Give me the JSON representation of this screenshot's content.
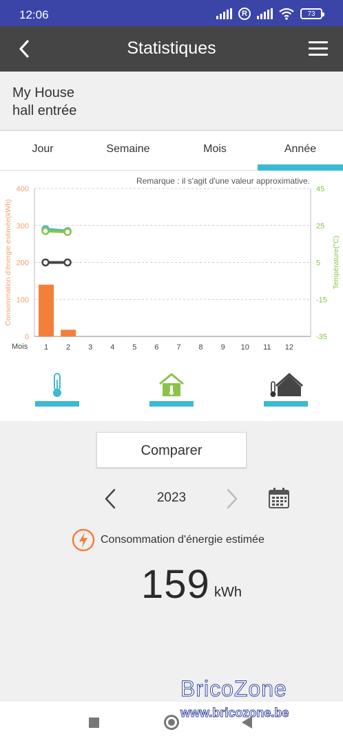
{
  "status_bar": {
    "time": "12:06",
    "battery": "73"
  },
  "app_bar": {
    "title": "Statistiques"
  },
  "device": {
    "home": "My House",
    "room": "hall entrée"
  },
  "tabs": [
    {
      "label": "Jour",
      "active": false
    },
    {
      "label": "Semaine",
      "active": false
    },
    {
      "label": "Mois",
      "active": false
    },
    {
      "label": "Année",
      "active": true
    }
  ],
  "chart": {
    "remark": "Remarque : il s'agit d'une valeur approximative.",
    "xlabel": "Mois",
    "ylabel_left": "Consommation d'énergie estimée(kWh)",
    "ylabel_right": "Température(°C)"
  },
  "chart_data": {
    "type": "bar",
    "categories": [
      "1",
      "2",
      "3",
      "4",
      "5",
      "6",
      "7",
      "8",
      "9",
      "10",
      "11",
      "12"
    ],
    "values": [
      140,
      18,
      0,
      0,
      0,
      0,
      0,
      0,
      0,
      0,
      0,
      0
    ],
    "ylim": [
      0,
      400
    ],
    "yticks": [
      0,
      100,
      200,
      300,
      400
    ],
    "y2lim": [
      -35,
      45
    ],
    "y2ticks": [
      -35,
      -15,
      5,
      25,
      45
    ],
    "line_series": [
      {
        "color": "#3cb9d3",
        "values": [
          23,
          22
        ]
      },
      {
        "color": "#8bc34a",
        "values": [
          22,
          21.5
        ]
      },
      {
        "color": "#454545",
        "values": [
          5,
          5
        ]
      }
    ],
    "colors": {
      "bars": "#f47f3a",
      "left_axis": "#f4a170",
      "right_axis": "#8bc34a"
    }
  },
  "view_icons": [
    {
      "name": "thermometer-icon"
    },
    {
      "name": "home-thermometer-icon"
    },
    {
      "name": "thermometer-home-icon"
    }
  ],
  "compare": {
    "label": "Comparer"
  },
  "year": {
    "value": "2023"
  },
  "energy": {
    "label": "Consommation d'énergie estimée",
    "value": "159",
    "unit": "kWh"
  },
  "watermark": {
    "brand": "BricoZone",
    "url": "www.bricozone.be"
  },
  "colors": {
    "status_bar": "#3b45a8",
    "app_bar": "#454545",
    "accent": "#3cb9d3",
    "energy_orange": "#f47f3a",
    "temp_green": "#8bc34a"
  }
}
